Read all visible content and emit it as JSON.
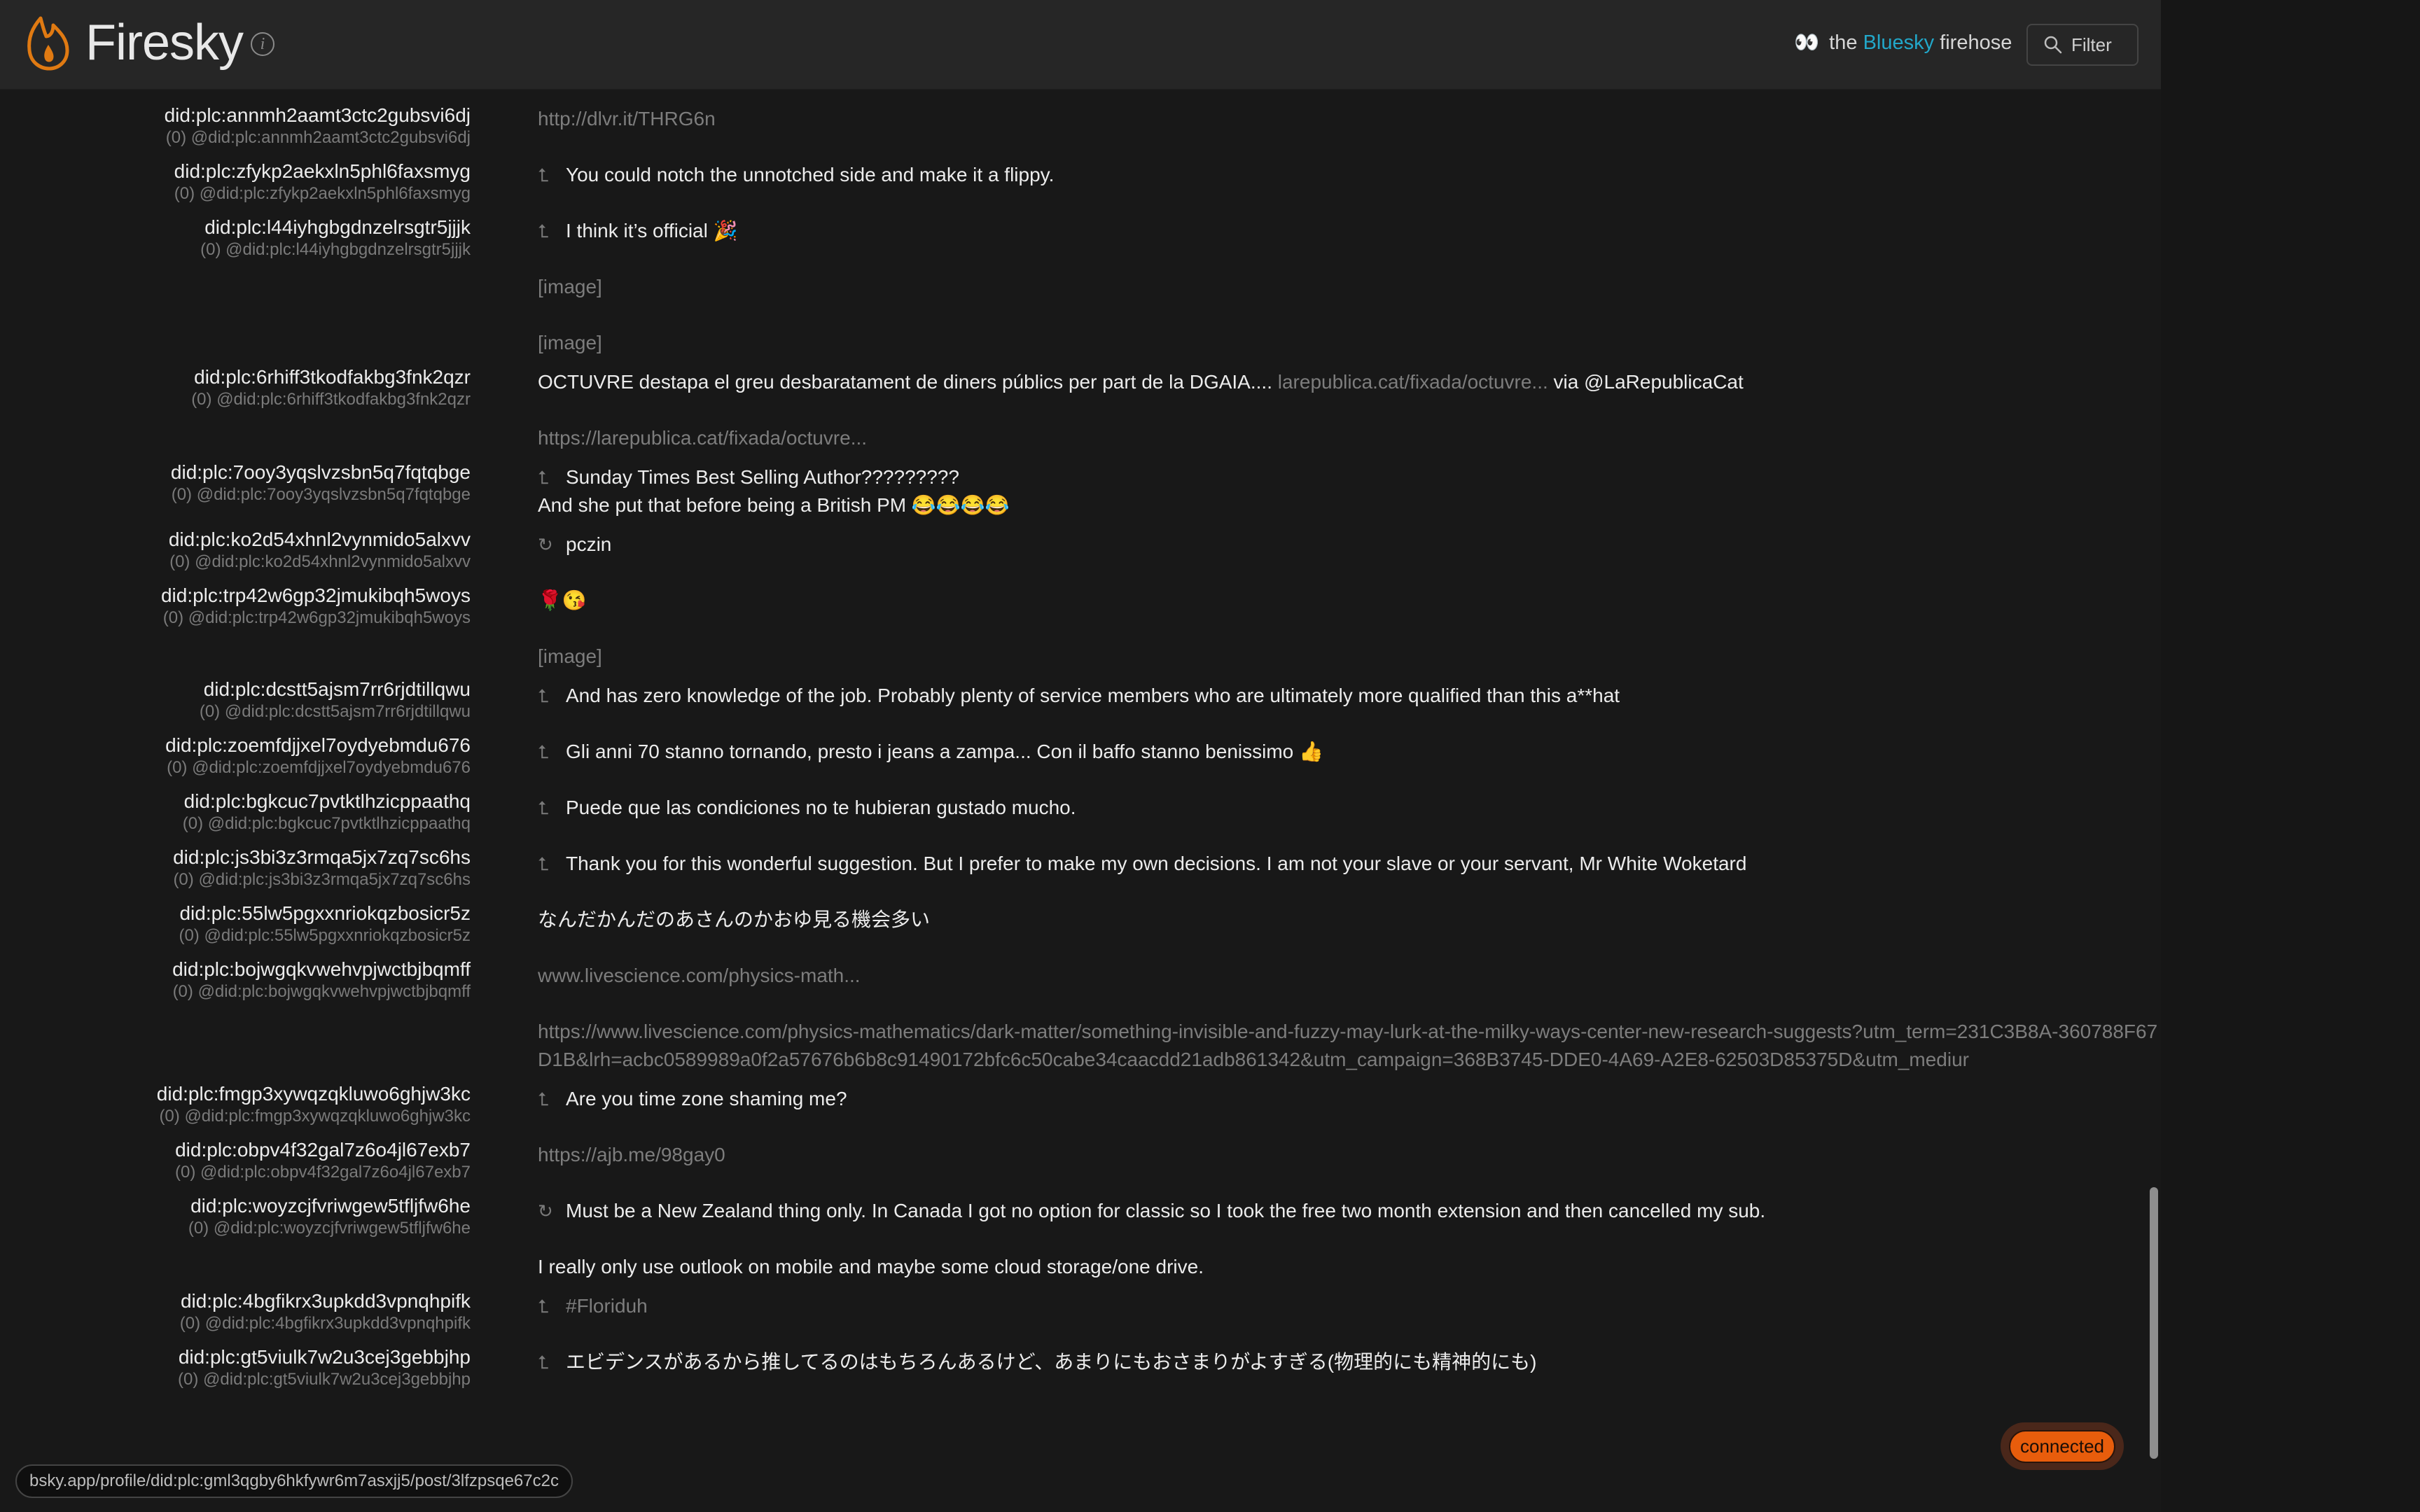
{
  "header": {
    "app_title": "Firesky",
    "tagline": {
      "eyes": "👀",
      "prefix": "the",
      "brand": "Bluesky",
      "suffix": "firehose"
    },
    "filter_label": "Filter"
  },
  "colors": {
    "accent_orange": "#e07a12",
    "brand_blue": "#22a7c9",
    "status_orange": "#e85d0c",
    "background": "#181818",
    "header": "#262626"
  },
  "authors": [
    {
      "did": "did:plc:annmh2aamt3ctc2gubsvi6dj",
      "handle": "(0) @did:plc:annmh2aamt3ctc2gubsvi6dj"
    },
    {
      "did": "did:plc:zfykp2aekxln5phl6faxsmyg",
      "handle": "(0) @did:plc:zfykp2aekxln5phl6faxsmyg"
    },
    {
      "did": "did:plc:l44iyhgbgdnzelrsgtr5jjjk",
      "handle": "(0) @did:plc:l44iyhgbgdnzelrsgtr5jjjk"
    },
    {
      "did": "did:plc:6rhiff3tkodfakbg3fnk2qzr",
      "handle": "(0) @did:plc:6rhiff3tkodfakbg3fnk2qzr"
    },
    {
      "did": "did:plc:7ooy3yqslvzsbn5q7fqtqbge",
      "handle": "(0) @did:plc:7ooy3yqslvzsbn5q7fqtqbge"
    },
    {
      "did": "did:plc:ko2d54xhnl2vynmido5alxvv",
      "handle": "(0) @did:plc:ko2d54xhnl2vynmido5alxvv"
    },
    {
      "did": "did:plc:trp42w6gp32jmukibqh5woys",
      "handle": "(0) @did:plc:trp42w6gp32jmukibqh5woys"
    },
    {
      "did": "did:plc:dcstt5ajsm7rr6rjdtillqwu",
      "handle": "(0) @did:plc:dcstt5ajsm7rr6rjdtillqwu"
    },
    {
      "did": "did:plc:zoemfdjjxel7oydyebmdu676",
      "handle": "(0) @did:plc:zoemfdjjxel7oydyebmdu676"
    },
    {
      "did": "did:plc:bgkcuc7pvtktlhzicppaathq",
      "handle": "(0) @did:plc:bgkcuc7pvtktlhzicppaathq"
    },
    {
      "did": "did:plc:js3bi3z3rmqa5jx7zq7sc6hs",
      "handle": "(0) @did:plc:js3bi3z3rmqa5jx7zq7sc6hs"
    },
    {
      "did": "did:plc:55lw5pgxxnriokqzbosicr5z",
      "handle": "(0) @did:plc:55lw5pgxxnriokqzbosicr5z"
    },
    {
      "did": "did:plc:bojwgqkvwehvpjwctbjbqmff",
      "handle": "(0) @did:plc:bojwgqkvwehvpjwctbjbqmff"
    },
    {
      "did": "did:plc:fmgp3xywqzqkluwo6ghjw3kc",
      "handle": "(0) @did:plc:fmgp3xywqzqkluwo6ghjw3kc"
    },
    {
      "did": "did:plc:obpv4f32gal7z6o4jl67exb7",
      "handle": "(0) @did:plc:obpv4f32gal7z6o4jl67exb7"
    },
    {
      "did": "did:plc:woyzcjfvriwgew5tfljfw6he",
      "handle": "(0) @did:plc:woyzcjfvriwgew5tfljfw6he"
    },
    {
      "did": "did:plc:4bgfikrx3upkdd3vpnqhpifk",
      "handle": "(0) @did:plc:4bgfikrx3upkdd3vpnqhpifk"
    },
    {
      "did": "did:plc:gt5viulk7w2u3cej3gebbjhp",
      "handle": "(0) @did:plc:gt5viulk7w2u3cej3gebbjhp"
    }
  ],
  "posts": [
    {
      "type": "link",
      "text": "http://dlvr.it/THRG6n"
    },
    {
      "type": "reply",
      "icon": "reply-icon",
      "text": "You could notch the unnotched side and make it a flippy."
    },
    {
      "type": "reply",
      "icon": "reply-icon",
      "text": "I think it’s official 🎉"
    },
    {
      "type": "media",
      "text": "[image]"
    },
    {
      "type": "media",
      "text": "[image]"
    },
    {
      "type": "post",
      "text": "OCTUVRE destapa el greu desbaratament de diners públics per part de la DGAIA....",
      "link": "larepublica.cat/fixada/octuvre...",
      "suffix": "via @LaRepublicaCat"
    },
    {
      "type": "link",
      "text": "https://larepublica.cat/fixada/octuvre..."
    },
    {
      "type": "reply",
      "icon": "reply-icon",
      "text": "Sunday Times Best Selling Author?????????",
      "line2": "And she put that before being a British PM 😂😂😂😂"
    },
    {
      "type": "repost",
      "icon": "repost-icon",
      "text": "pczin"
    },
    {
      "type": "post",
      "text": "🌹😘"
    },
    {
      "type": "media",
      "text": "[image]"
    },
    {
      "type": "reply",
      "icon": "reply-icon",
      "text": "And has zero knowledge of the job. Probably plenty of service members who are ultimately more qualified than this a**hat"
    },
    {
      "type": "reply",
      "icon": "reply-icon",
      "text": "Gli anni 70 stanno tornando, presto i jeans a zampa... Con il baffo stanno benissimo 👍"
    },
    {
      "type": "reply",
      "icon": "reply-icon",
      "text": "Puede que las condiciones no te hubieran gustado mucho."
    },
    {
      "type": "reply",
      "icon": "reply-icon",
      "text": "Thank you for this wonderful suggestion. But I prefer to make my own decisions. I am not your slave or your servant, Mr White Woketard"
    },
    {
      "type": "post",
      "text": "なんだかんだのあさんのかおゆ見る機会多い"
    },
    {
      "type": "link",
      "text": "www.livescience.com/physics-math..."
    },
    {
      "type": "link",
      "text": "https://www.livescience.com/physics-mathematics/dark-matter/something-invisible-and-fuzzy-may-lurk-at-the-milky-ways-center-new-research-suggests?utm_term=231C3B8A-360788F67D1B&lrh=acbc0589989a0f2a57676b6b8c91490172bfc6c50cabe34caacdd21adb861342&utm_campaign=368B3745-DDE0-4A69-A2E8-62503D85375D&utm_mediur"
    },
    {
      "type": "reply",
      "icon": "reply-icon",
      "text": "Are you time zone shaming me?"
    },
    {
      "type": "link",
      "text": "https://ajb.me/98gay0"
    },
    {
      "type": "repost",
      "icon": "repost-icon",
      "text": "Must be a New Zealand thing only. In Canada I got no option for classic so I took the free two month extension and then cancelled my sub."
    },
    {
      "type": "post",
      "text": "I really only use outlook on mobile and maybe some cloud storage/one drive."
    },
    {
      "type": "reply",
      "icon": "reply-icon",
      "text": "#Floriduh",
      "muted": true
    },
    {
      "type": "reply",
      "icon": "reply-icon",
      "text": "エビデンスがあるから推してるのはもちろんあるけど、あまりにもおさまりがよすぎる(物理的にも精神的にも)"
    }
  ],
  "status": {
    "label": "connected"
  },
  "hover_url": "bsky.app/profile/did:plc:gml3qgby6hkfywr6m7asxjj5/post/3lfzpsqe67c2c"
}
